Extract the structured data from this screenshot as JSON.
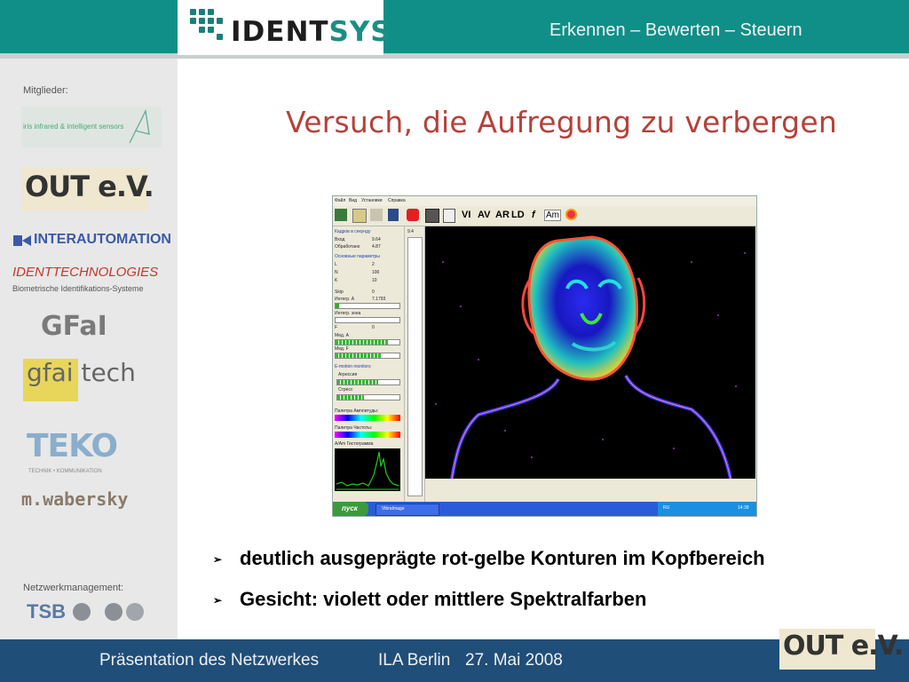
{
  "header": {
    "brand_left": "IDENT",
    "brand_right": "SYS",
    "tagline": "Erkennen – Bewerten – Steuern"
  },
  "sidebar": {
    "members_label": "Mitglieder:",
    "members": [
      {
        "name": "iris infrared & intelligent sensors"
      },
      {
        "name": "OUT e.V."
      },
      {
        "name": "INTERAUTOMATION"
      },
      {
        "name": "IDENTTECHNOLOGIES",
        "subtitle": "Biometrische Identifikations-Systeme"
      },
      {
        "name": "GFaI"
      },
      {
        "name": "gfai tech"
      },
      {
        "name": "TEKO",
        "subtitle": "TECHNIK • KOMMUNIKATION"
      },
      {
        "name": "m.wabersky"
      }
    ],
    "network_label": "Netzwerkmanagement:",
    "network_logo": "TSB"
  },
  "slide": {
    "title": "Versuch, die Aufregung zu verbergen",
    "bullets": [
      "deutlich ausgeprägte rot-gelbe Konturen im Kopfbereich",
      "Gesicht: violett oder mittlere Spektralfarben"
    ]
  },
  "screenshot": {
    "menu": [
      "Файл",
      "Вид",
      "Установки",
      "Справка"
    ],
    "toolbar_labels": [
      "VI",
      "AV",
      "AR",
      "LD",
      "f",
      "Am"
    ],
    "panel_rows": [
      {
        "label": "Кадров в секунду",
        "value": ""
      },
      {
        "label": "Вход",
        "value": "9.64"
      },
      {
        "label": "Обработано",
        "value": "4.87"
      },
      {
        "label": "Основные параметры",
        "value": ""
      },
      {
        "label": "L",
        "value": "2"
      },
      {
        "label": "N",
        "value": "100"
      },
      {
        "label": "K",
        "value": "10"
      },
      {
        "label": "Skip",
        "value": "0"
      },
      {
        "label": "Интегр. А",
        "value": "7.1793"
      },
      {
        "label": "Интегр. зона",
        "value": ""
      },
      {
        "label": "F",
        "value": "0"
      },
      {
        "label": "Мед. А",
        "value": ""
      },
      {
        "label": "Мед. F",
        "value": ""
      },
      {
        "label": "E-motion monitors",
        "value": ""
      },
      {
        "label": "Агрессия",
        "value": ""
      },
      {
        "label": "Стресс",
        "value": ""
      },
      {
        "label": "Палитра Амплитуды:",
        "value": ""
      },
      {
        "label": "Палитра Частоты:",
        "value": ""
      },
      {
        "label": "A/Am Гистограмма",
        "value": ""
      }
    ],
    "side_value": "9.4",
    "taskbar_start": "пуск",
    "taskbar_window": "VibraImage",
    "taskbar_lang": "RU",
    "taskbar_clock": "14:39"
  },
  "footer": {
    "left": "Präsentation des Netzwerkes",
    "event": "ILA Berlin",
    "date": "27. Mai 2008",
    "logo": "OUT e.V."
  },
  "colors": {
    "teal": "#0f8f87",
    "navy": "#1f4e79",
    "title_red": "#b5413a",
    "sidebar": "#e8e8e8"
  }
}
